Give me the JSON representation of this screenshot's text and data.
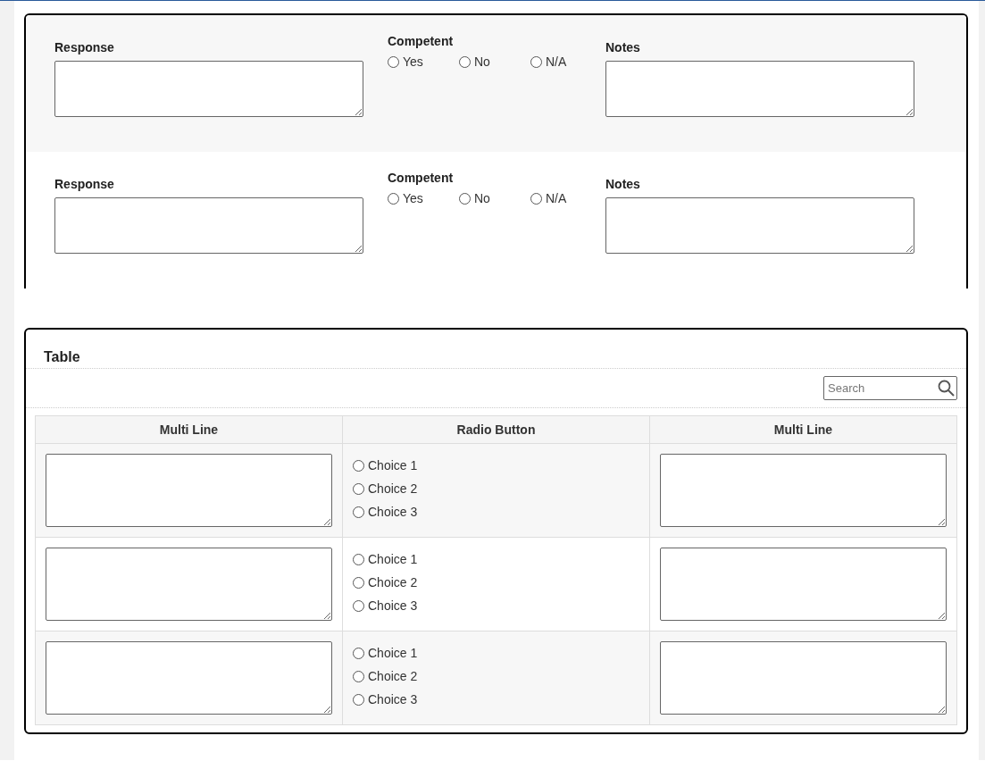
{
  "assessment_rows": [
    {
      "response": {
        "label": "Response"
      },
      "competent": {
        "label": "Competent",
        "options": [
          {
            "label": "Yes",
            "selected": false
          },
          {
            "label": "No",
            "selected": false
          },
          {
            "label": "N/A",
            "selected": false
          }
        ]
      },
      "notes": {
        "label": "Notes"
      }
    },
    {
      "response": {
        "label": "Response"
      },
      "competent": {
        "label": "Competent",
        "options": [
          {
            "label": "Yes",
            "selected": false
          },
          {
            "label": "No",
            "selected": false
          },
          {
            "label": "N/A",
            "selected": false
          }
        ]
      },
      "notes": {
        "label": "Notes"
      }
    }
  ],
  "table": {
    "title": "Table",
    "search": {
      "placeholder": "Search"
    },
    "columns": [
      "Multi Line",
      "Radio Button",
      "Multi Line"
    ],
    "rows": [
      {
        "choices": [
          {
            "label": "Choice 1",
            "selected": false
          },
          {
            "label": "Choice 2",
            "selected": false
          },
          {
            "label": "Choice 3",
            "selected": false
          }
        ]
      },
      {
        "choices": [
          {
            "label": "Choice 1",
            "selected": false
          },
          {
            "label": "Choice 2",
            "selected": false
          },
          {
            "label": "Choice 3",
            "selected": false
          }
        ]
      },
      {
        "choices": [
          {
            "label": "Choice 1",
            "selected": false
          },
          {
            "label": "Choice 2",
            "selected": false
          },
          {
            "label": "Choice 3",
            "selected": false
          }
        ]
      }
    ]
  }
}
